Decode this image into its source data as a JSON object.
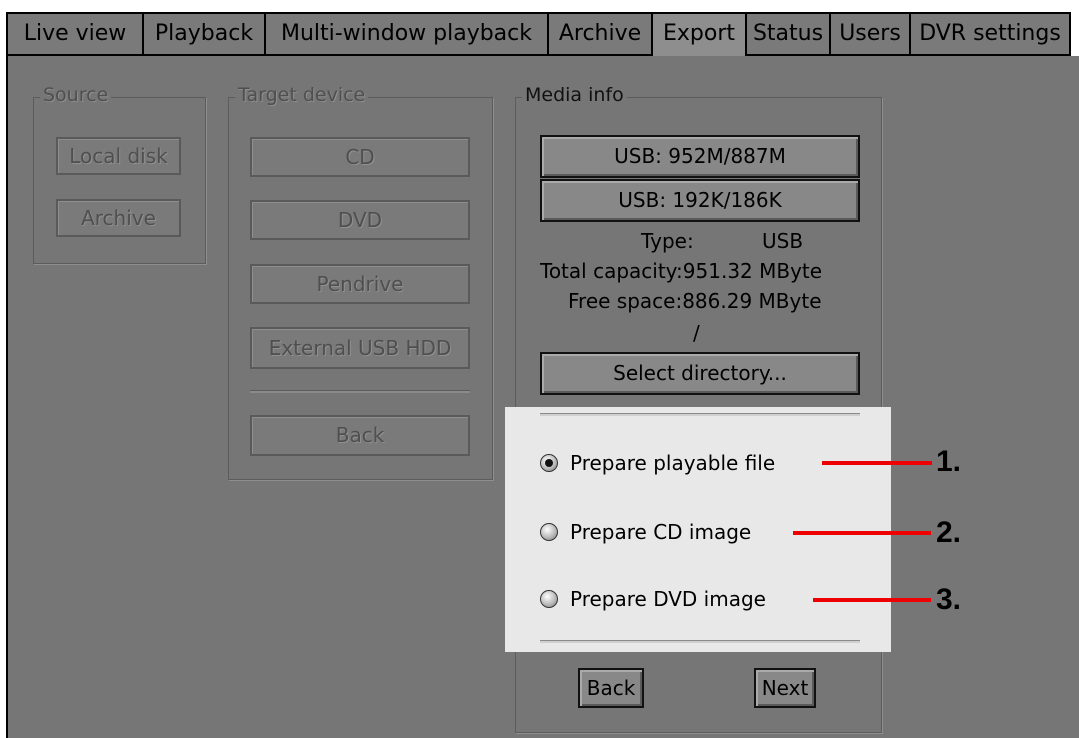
{
  "tabs": [
    "Live view",
    "Playback",
    "Multi-window playback",
    "Archive",
    "Export",
    "Status",
    "Users",
    "DVR settings"
  ],
  "active_tab": "Export",
  "source": {
    "title": "Source",
    "buttons": [
      "Local disk",
      "Archive"
    ]
  },
  "target": {
    "title": "Target device",
    "buttons": [
      "CD",
      "DVD",
      "Pendrive",
      "External USB HDD"
    ],
    "back_label": "Back"
  },
  "media": {
    "title": "Media info",
    "device_buttons": [
      "USB: 952M/887M",
      "USB: 192K/186K"
    ],
    "type_label": "Type:",
    "type_value": "USB",
    "total_capacity": "Total capacity:951.32 MByte",
    "free_space": "Free space:886.29 MByte",
    "path": "/",
    "select_dir_label": "Select directory...",
    "options": [
      "Prepare playable file",
      "Prepare CD image",
      "Prepare DVD image"
    ],
    "selected_option": "Prepare playable file",
    "back_label": "Back",
    "next_label": "Next"
  },
  "callouts": [
    "1.",
    "2.",
    "3."
  ],
  "colors": {
    "panel": "#767676",
    "highlight": "#e8e8e8",
    "callout_line": "#e00000"
  }
}
